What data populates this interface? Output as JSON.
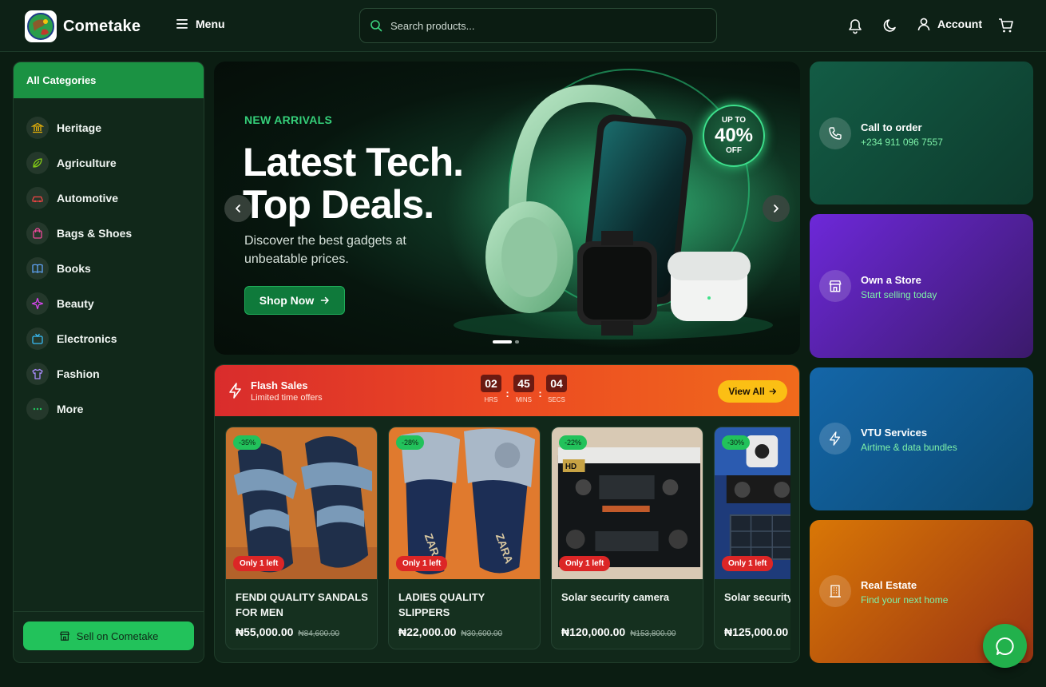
{
  "brand": {
    "name": "Cometake"
  },
  "header": {
    "menu_label": "Menu",
    "search_placeholder": "Search products...",
    "account_label": "Account"
  },
  "sidebar": {
    "heading": "All Categories",
    "items": [
      {
        "label": "Heritage",
        "icon": "bank-icon",
        "color": "#eab308"
      },
      {
        "label": "Agriculture",
        "icon": "leaf-icon",
        "color": "#84cc16"
      },
      {
        "label": "Automotive",
        "icon": "car-icon",
        "color": "#ef4444"
      },
      {
        "label": "Bags & Shoes",
        "icon": "bag-icon",
        "color": "#ec4899"
      },
      {
        "label": "Books",
        "icon": "book-icon",
        "color": "#60a5fa"
      },
      {
        "label": "Beauty",
        "icon": "sparkle-icon",
        "color": "#d946ef"
      },
      {
        "label": "Electronics",
        "icon": "tv-icon",
        "color": "#38bdf8"
      },
      {
        "label": "Fashion",
        "icon": "shirt-icon",
        "color": "#a78bfa"
      },
      {
        "label": "More",
        "icon": "more-icon",
        "color": "#22c55e"
      }
    ],
    "sell_label": "Sell on Cometake"
  },
  "hero": {
    "eyebrow": "NEW ARRIVALS",
    "title": "Latest Tech.\nTop Deals.",
    "description": "Discover the best gadgets at unbeatable prices.",
    "cta": "Shop Now",
    "badge": {
      "top": "UP TO",
      "value": "40%",
      "bottom": "OFF"
    }
  },
  "flash": {
    "title": "Flash Sales",
    "subtitle": "Limited time offers",
    "countdown": [
      {
        "value": "02",
        "label": "HRS"
      },
      {
        "value": "45",
        "label": "MINS"
      },
      {
        "value": "04",
        "label": "SECS"
      }
    ],
    "view_all": "View All",
    "products": [
      {
        "name": "FENDI QUALITY SANDALS FOR MEN",
        "price": "₦55,000.00",
        "old_price": "₦84,600.00",
        "discount": "-35%",
        "stock": "Only 1 left"
      },
      {
        "name": "LADIES QUALITY SLIPPERS",
        "price": "₦22,000.00",
        "old_price": "₦30,600.00",
        "discount": "-28%",
        "stock": "Only 1 left"
      },
      {
        "name": "Solar security camera",
        "price": "₦120,000.00",
        "old_price": "₦153,800.00",
        "discount": "-22%",
        "stock": "Only 1 left"
      },
      {
        "name": "Solar security",
        "price": "₦125,000.00",
        "old_price": "",
        "discount": "-30%",
        "stock": "Only 1 left"
      }
    ]
  },
  "tiles": [
    {
      "title": "Call to order",
      "subtitle": "+234 911 096 7557",
      "icon": "phone-icon",
      "gradient": [
        "#135c45",
        "#0d3b2d"
      ]
    },
    {
      "title": "Own a Store",
      "subtitle": "Start selling today",
      "icon": "store-icon",
      "gradient": [
        "#6d28d9",
        "#3b1a6b"
      ]
    },
    {
      "title": "VTU Services",
      "subtitle": "Airtime & data bundles",
      "icon": "bolt-icon",
      "gradient": [
        "#1466a8",
        "#0b4a73"
      ]
    },
    {
      "title": "Real Estate",
      "subtitle": "Find your next home",
      "icon": "building-icon",
      "gradient": [
        "#d97706",
        "#9a3412"
      ]
    }
  ]
}
